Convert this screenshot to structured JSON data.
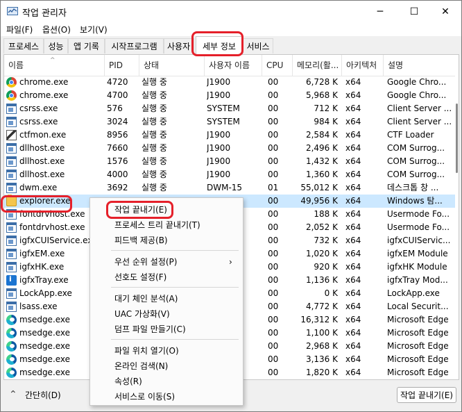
{
  "window": {
    "title": "작업 관리자",
    "controls": {
      "minimize": "─",
      "maximize": "☐",
      "close": "✕"
    }
  },
  "menubar": [
    "파일(F)",
    "옵션(O)",
    "보기(V)"
  ],
  "tabs": [
    "프로세스",
    "성능",
    "앱 기록",
    "시작프로그램",
    "사용자",
    "세부 정보",
    "서비스"
  ],
  "columns": [
    "이름",
    "PID",
    "상태",
    "사용자 이름",
    "CPU",
    "메모리(활...",
    "아키텍처",
    "설명"
  ],
  "rows": [
    {
      "name": "chrome.exe",
      "pid": "4720",
      "status": "실행 중",
      "user": "J1900",
      "cpu": "00",
      "mem": "6,728 K",
      "arch": "x64",
      "desc": "Google Chro...",
      "icon": "chrome-icon"
    },
    {
      "name": "chrome.exe",
      "pid": "4700",
      "status": "실행 중",
      "user": "J1900",
      "cpu": "00",
      "mem": "5,968 K",
      "arch": "x64",
      "desc": "Google Chro...",
      "icon": "chrome-icon"
    },
    {
      "name": "csrss.exe",
      "pid": "576",
      "status": "실행 중",
      "user": "SYSTEM",
      "cpu": "00",
      "mem": "712 K",
      "arch": "x64",
      "desc": "Client Server ...",
      "icon": "window-icon"
    },
    {
      "name": "csrss.exe",
      "pid": "3024",
      "status": "실행 중",
      "user": "SYSTEM",
      "cpu": "00",
      "mem": "984 K",
      "arch": "x64",
      "desc": "Client Server ...",
      "icon": "window-icon"
    },
    {
      "name": "ctfmon.exe",
      "pid": "8956",
      "status": "실행 중",
      "user": "J1900",
      "cpu": "00",
      "mem": "2,584 K",
      "arch": "x64",
      "desc": "CTF Loader",
      "icon": "pen-icon"
    },
    {
      "name": "dllhost.exe",
      "pid": "7660",
      "status": "실행 중",
      "user": "J1900",
      "cpu": "00",
      "mem": "2,496 K",
      "arch": "x64",
      "desc": "COM Surrog...",
      "icon": "window-icon"
    },
    {
      "name": "dllhost.exe",
      "pid": "1576",
      "status": "실행 중",
      "user": "J1900",
      "cpu": "00",
      "mem": "1,432 K",
      "arch": "x64",
      "desc": "COM Surrog...",
      "icon": "window-icon"
    },
    {
      "name": "dllhost.exe",
      "pid": "4000",
      "status": "실행 중",
      "user": "J1900",
      "cpu": "00",
      "mem": "1,360 K",
      "arch": "x64",
      "desc": "COM Surrog...",
      "icon": "window-icon"
    },
    {
      "name": "dwm.exe",
      "pid": "3692",
      "status": "실행 중",
      "user": "DWM-15",
      "cpu": "01",
      "mem": "55,012 K",
      "arch": "x64",
      "desc": "데스크톱 창 ...",
      "icon": "window-icon"
    },
    {
      "name": "explorer.exe",
      "pid": "",
      "status": "",
      "user": "",
      "cpu": "00",
      "mem": "49,956 K",
      "arch": "x64",
      "desc": "Windows 탐...",
      "icon": "folder-icon"
    },
    {
      "name": "fontdrvhost.exe",
      "pid": "",
      "status": "",
      "user": "",
      "cpu": "00",
      "mem": "188 K",
      "arch": "x64",
      "desc": "Usermode Fo...",
      "icon": "window-icon"
    },
    {
      "name": "fontdrvhost.exe",
      "pid": "",
      "status": "",
      "user": "",
      "cpu": "00",
      "mem": "2,052 K",
      "arch": "x64",
      "desc": "Usermode Fo...",
      "icon": "window-icon"
    },
    {
      "name": "igfxCUIService.exe",
      "pid": "",
      "status": "",
      "user": "",
      "cpu": "00",
      "mem": "732 K",
      "arch": "x64",
      "desc": "igfxCUIServic...",
      "icon": "window-icon"
    },
    {
      "name": "igfxEM.exe",
      "pid": "",
      "status": "",
      "user": "",
      "cpu": "00",
      "mem": "1,020 K",
      "arch": "x64",
      "desc": "igfxEM Module",
      "icon": "window-icon"
    },
    {
      "name": "igfxHK.exe",
      "pid": "",
      "status": "",
      "user": "",
      "cpu": "00",
      "mem": "920 K",
      "arch": "x64",
      "desc": "igfxHK Module",
      "icon": "window-icon"
    },
    {
      "name": "igfxTray.exe",
      "pid": "",
      "status": "",
      "user": "",
      "cpu": "00",
      "mem": "1,136 K",
      "arch": "x64",
      "desc": "igfxTray Mod...",
      "icon": "tray-icon"
    },
    {
      "name": "LockApp.exe",
      "pid": "",
      "status": "",
      "user": "",
      "cpu": "00",
      "mem": "0 K",
      "arch": "x64",
      "desc": "LockApp.exe",
      "icon": "window-icon"
    },
    {
      "name": "lsass.exe",
      "pid": "",
      "status": "",
      "user": "",
      "cpu": "00",
      "mem": "4,772 K",
      "arch": "x64",
      "desc": "Local Securit...",
      "icon": "window-icon"
    },
    {
      "name": "msedge.exe",
      "pid": "",
      "status": "",
      "user": "",
      "cpu": "00",
      "mem": "16,312 K",
      "arch": "x64",
      "desc": "Microsoft Edge",
      "icon": "edge-icon"
    },
    {
      "name": "msedge.exe",
      "pid": "",
      "status": "",
      "user": "",
      "cpu": "00",
      "mem": "1,100 K",
      "arch": "x64",
      "desc": "Microsoft Edge",
      "icon": "edge-icon"
    },
    {
      "name": "msedge.exe",
      "pid": "",
      "status": "",
      "user": "",
      "cpu": "00",
      "mem": "2,968 K",
      "arch": "x64",
      "desc": "Microsoft Edge",
      "icon": "edge-icon"
    },
    {
      "name": "msedge.exe",
      "pid": "",
      "status": "",
      "user": "",
      "cpu": "00",
      "mem": "3,136 K",
      "arch": "x64",
      "desc": "Microsoft Edge",
      "icon": "edge-icon"
    },
    {
      "name": "msedge.exe",
      "pid": "",
      "status": "",
      "user": "",
      "cpu": "00",
      "mem": "1,820 K",
      "arch": "x64",
      "desc": "Microsoft Edge",
      "icon": "edge-icon"
    }
  ],
  "context_menu": [
    {
      "label": "작업 끝내기(E)"
    },
    {
      "label": "프로세스 트리 끝내기(T)"
    },
    {
      "label": "피드백 제공(B)"
    },
    {
      "label": "우선 순위 설정(P)",
      "submenu": "›"
    },
    {
      "label": "선호도 설정(F)"
    },
    {
      "label": "대기 체인 분석(A)"
    },
    {
      "label": "UAC 가상화(V)"
    },
    {
      "label": "덤프 파일 만들기(C)"
    },
    {
      "label": "파일 위치 열기(O)"
    },
    {
      "label": "온라인 검색(N)"
    },
    {
      "label": "속성(R)"
    },
    {
      "label": "서비스로 이동(S)"
    }
  ],
  "bottom": {
    "collapse_label": "간단히(D)",
    "end_task_label": "작업 끝내기(E)"
  },
  "colors": {
    "selected_row": "#cce8ff",
    "highlight": "#e5202a"
  }
}
